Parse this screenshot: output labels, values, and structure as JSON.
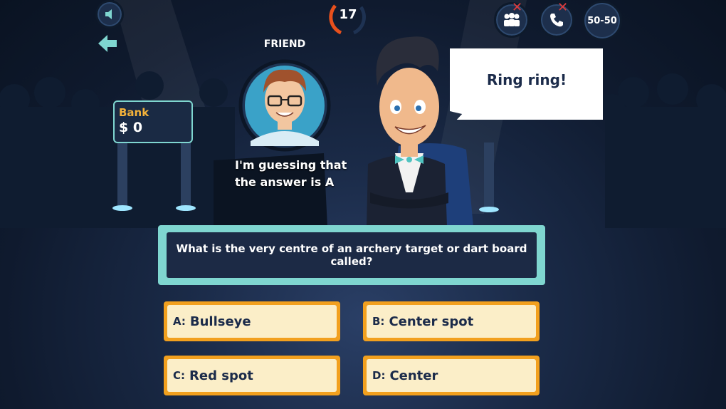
{
  "header": {
    "timer_value": "17",
    "lifelines": {
      "ask_audience_icon": "audience-icon",
      "phone_friend_icon": "phone-icon",
      "fifty_fifty_label": "50-50"
    }
  },
  "controls": {
    "sound_icon": "speaker-icon",
    "back_icon": "back-arrow-icon"
  },
  "bank": {
    "label": "Bank",
    "value": "$ 0"
  },
  "friend": {
    "title": "FRIEND",
    "line1": "I'm guessing that",
    "line2": "the answer is A"
  },
  "host": {
    "speech": "Ring ring!"
  },
  "question": {
    "text": "What is the very centre of an archery target or dart board called?"
  },
  "answers": [
    {
      "letter": "A:",
      "text": "Bullseye"
    },
    {
      "letter": "B:",
      "text": "Center spot"
    },
    {
      "letter": "C:",
      "text": "Red spot"
    },
    {
      "letter": "D:",
      "text": "Center"
    }
  ],
  "colors": {
    "accent_teal": "#7fd6d0",
    "answer_border": "#f2a01e",
    "answer_fill": "#fbeec8",
    "bank_label": "#f4b23a",
    "disabled_x": "#e23a3a"
  }
}
